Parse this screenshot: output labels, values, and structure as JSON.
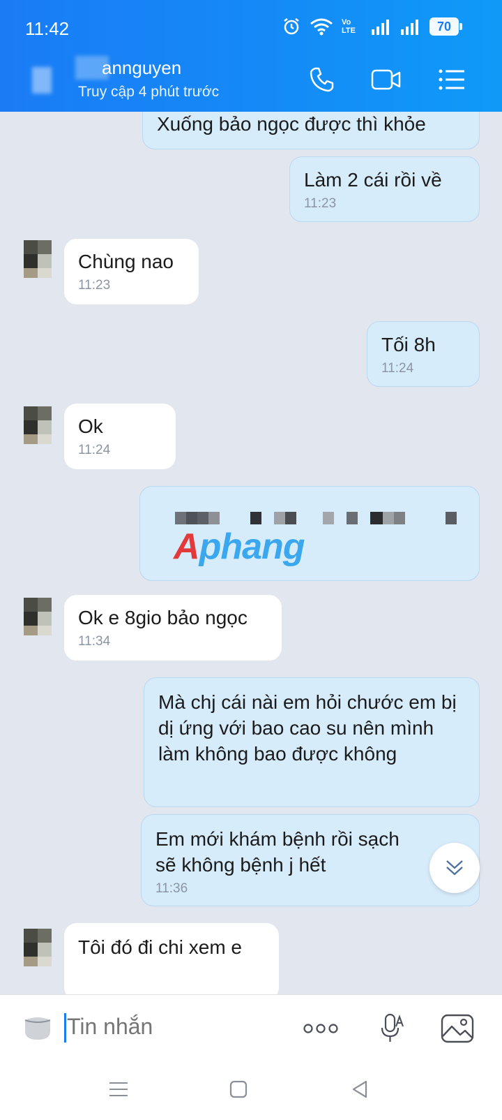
{
  "status_bar": {
    "time": "11:42",
    "battery": "70",
    "network_label": "Vo LTE"
  },
  "header": {
    "contact_name": "annguyen",
    "contact_status": "Truy cập 4 phút trước"
  },
  "messages": [
    {
      "side": "out",
      "text": "Xuống bảo ngọc được thì khỏe",
      "time": ""
    },
    {
      "side": "out",
      "text": "Làm 2 cái rồi về",
      "time": "11:23"
    },
    {
      "side": "in",
      "text": "Chùng nao",
      "time": "11:23"
    },
    {
      "side": "out",
      "text": "Tối 8h",
      "time": "11:24"
    },
    {
      "side": "in",
      "text": "Ok",
      "time": "11:24"
    },
    {
      "side": "in",
      "text": "Ok e 8gio bảo ngọc",
      "time": "11:34"
    },
    {
      "side": "out",
      "text": "Mà chj cái nài em hỏi chước em bị dị ứng với bao cao su nên mình làm không bao được không",
      "time": ""
    },
    {
      "side": "out",
      "text": "Em mới khám bệnh rồi sạch sẽ không bệnh j hết",
      "time": "11:36"
    },
    {
      "side": "in",
      "text": "Tôi đó đi chi xem e",
      "time": ""
    }
  ],
  "image_message": {
    "watermark_left": "A",
    "watermark_right": "phang"
  },
  "input": {
    "placeholder": "Tin nhắn"
  },
  "colors": {
    "header": "#1589f7",
    "outgoing_bubble": "#d7ecfb",
    "incoming_bubble": "#ffffff",
    "chat_bg": "#e2e6ee"
  }
}
